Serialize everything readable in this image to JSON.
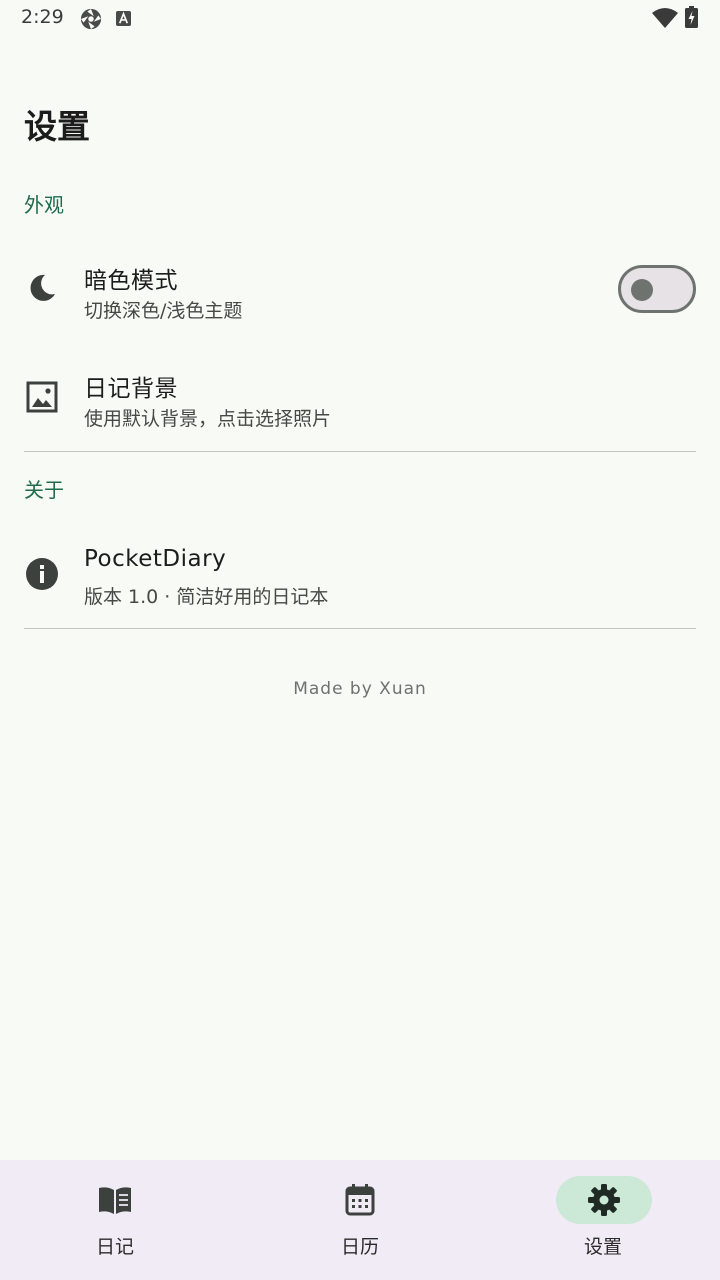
{
  "status_bar": {
    "time": "2:29",
    "icons": [
      "aperture-icon",
      "font-a-icon",
      "wifi-icon",
      "battery-charging-icon"
    ]
  },
  "page": {
    "title": "设置"
  },
  "sections": {
    "appearance": {
      "header": "外观",
      "dark_mode": {
        "title": "暗色模式",
        "subtitle": "切换深色/浅色主题",
        "icon": "moon-icon",
        "enabled": false
      },
      "diary_background": {
        "title": "日记背景",
        "subtitle": "使用默认背景，点击选择照片",
        "icon": "image-icon"
      }
    },
    "about": {
      "header": "关于",
      "app_info": {
        "title": "PocketDiary",
        "subtitle": "版本 1.0 · 简洁好用的日记本",
        "icon": "info-icon"
      }
    }
  },
  "footer": {
    "credit": "Made by Xuan"
  },
  "bottom_nav": {
    "items": [
      {
        "label": "日记",
        "icon": "book-icon",
        "active": false
      },
      {
        "label": "日历",
        "icon": "calendar-icon",
        "active": false
      },
      {
        "label": "设置",
        "icon": "gear-icon",
        "active": true
      }
    ]
  },
  "colors": {
    "background": "#f8faf6",
    "accent": "#1f6b4a",
    "nav_background": "#f1ebf5",
    "nav_active_pill": "#cce8d6"
  }
}
